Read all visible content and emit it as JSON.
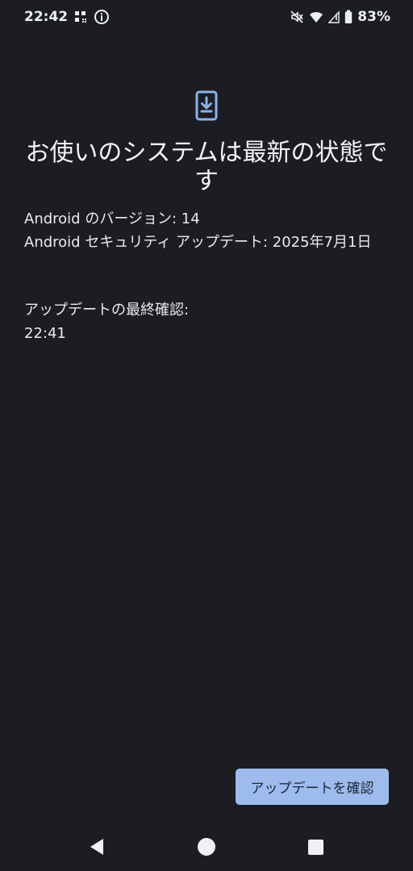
{
  "status_bar": {
    "time": "22:42",
    "battery": "83%",
    "icons": [
      "qr-grid-icon",
      "info-icon",
      "mute-icon",
      "wifi-icon",
      "signal-icon",
      "battery-icon"
    ]
  },
  "update_screen": {
    "icon": "phone-download-icon",
    "title": "お使いのシステムは最新の状態です",
    "android_version": "Android のバージョン: 14",
    "security_update": "Android セキュリティ アップデート: 2025年7月1日",
    "last_checked_label": "アップデートの最終確認:",
    "last_checked_time": "22:41",
    "check_button_label": "アップデートを確認"
  },
  "navigation": {
    "icons": [
      "back-icon",
      "home-icon",
      "recents-icon"
    ]
  },
  "colors": {
    "background": "#1b1d22",
    "accent": "#9dbbed",
    "icon_blue": "#8db2ea",
    "text": "#eceff4"
  }
}
